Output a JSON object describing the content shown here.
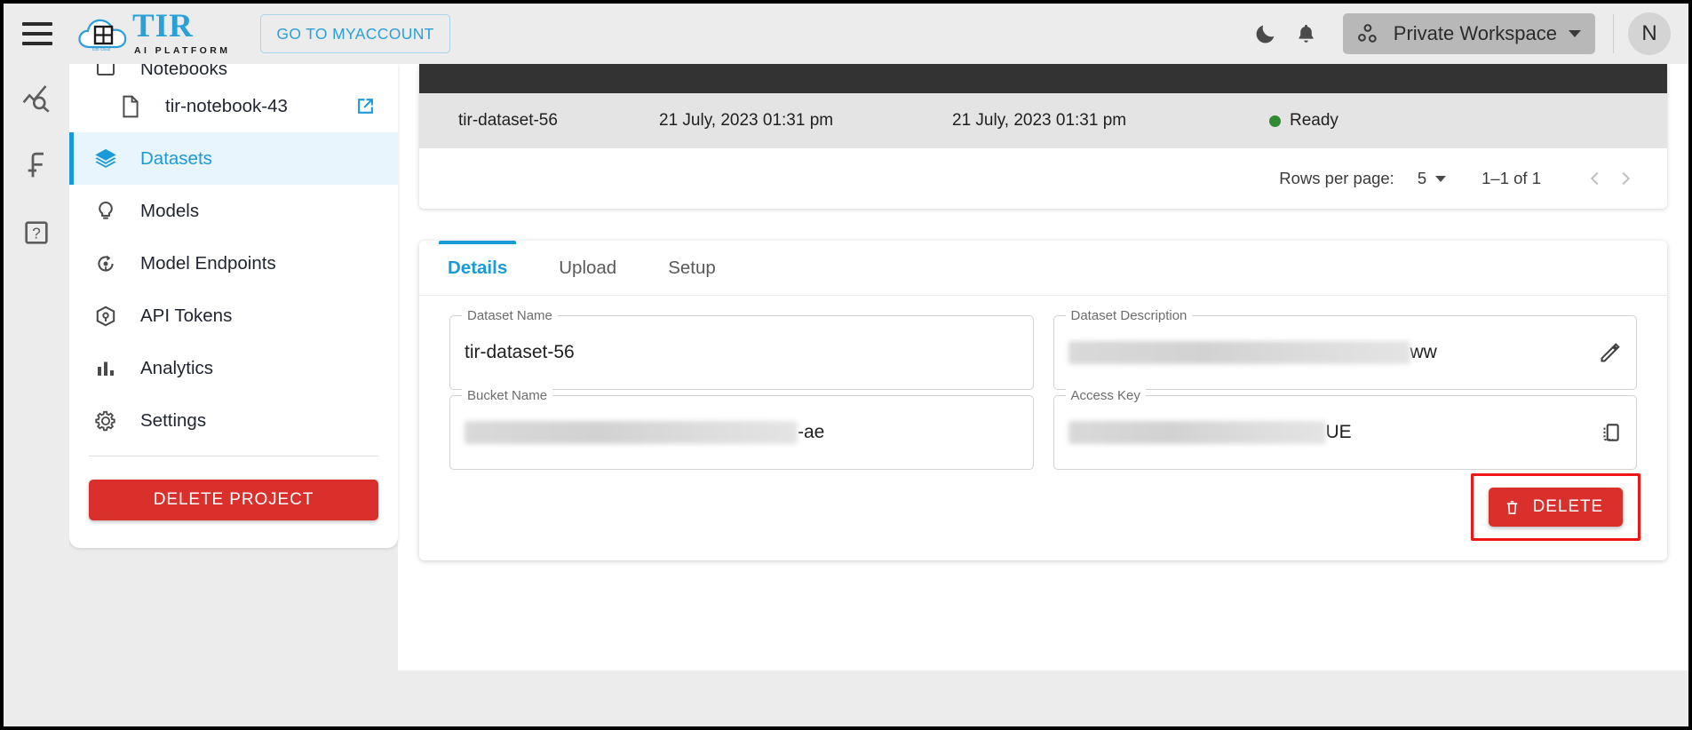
{
  "header": {
    "menu_icon": "hamburger-menu-icon",
    "brand_title": "TIR",
    "brand_subtitle": "AI PLATFORM",
    "brand_cloud_label": "E2E Cloud",
    "myaccount_label": "GO TO MYACCOUNT",
    "dark_mode_icon": "moon-icon",
    "notifications_icon": "bell-icon",
    "workspace_icon": "workspace-nodes-icon",
    "workspace_label": "Private Workspace",
    "workspace_caret": "chevron-down-icon",
    "avatar_initial": "N",
    "accent_blue": "#2a9fd8"
  },
  "rail": {
    "items": [
      {
        "icon": "chart-search-icon"
      },
      {
        "icon": "function-icon"
      },
      {
        "icon": "help-question-icon"
      }
    ]
  },
  "sidebar": {
    "items": [
      {
        "label": "Notebooks",
        "icon": "notebook-icon",
        "active": false,
        "clipped": true
      },
      {
        "label": "tir-notebook-43",
        "icon": "file-icon",
        "active": false,
        "child": true,
        "external": "external-link-icon"
      },
      {
        "label": "Datasets",
        "icon": "layers-icon",
        "active": true
      },
      {
        "label": "Models",
        "icon": "lightbulb-icon",
        "active": false
      },
      {
        "label": "Model Endpoints",
        "icon": "endpoint-refresh-icon",
        "active": false
      },
      {
        "label": "API Tokens",
        "icon": "cube-token-icon",
        "active": false
      },
      {
        "label": "Analytics",
        "icon": "bar-chart-icon",
        "active": false
      },
      {
        "label": "Settings",
        "icon": "gear-icon",
        "active": false
      }
    ],
    "delete_project_label": "DELETE PROJECT",
    "danger_color": "#d9302c"
  },
  "datasets_table": {
    "rows": [
      {
        "name": "tir-dataset-56",
        "created": "21 July, 2023 01:31 pm",
        "updated": "21 July, 2023 01:31 pm",
        "status": "Ready",
        "status_color": "#2f8a32"
      }
    ],
    "pagination": {
      "rows_per_page_label": "Rows per page:",
      "rows_per_page_value": "5",
      "range_label": "1–1 of 1",
      "prev_icon": "chevron-left-icon",
      "next_icon": "chevron-right-icon"
    }
  },
  "details_panel": {
    "tabs": [
      {
        "label": "Details",
        "active": true
      },
      {
        "label": "Upload",
        "active": false
      },
      {
        "label": "Setup",
        "active": false
      }
    ],
    "fields": {
      "dataset_name": {
        "legend": "Dataset Name",
        "value": "tir-dataset-56",
        "redacted": false
      },
      "dataset_description": {
        "legend": "Dataset Description",
        "value": "ww",
        "redacted": true,
        "trailing_icon": "edit-pencil-icon"
      },
      "bucket_name": {
        "legend": "Bucket Name",
        "value": "-ae",
        "redacted": true
      },
      "access_key": {
        "legend": "Access Key",
        "value": "UE",
        "redacted": true,
        "trailing_icon": "copy-icon"
      }
    },
    "delete_label": "DELETE",
    "delete_icon": "trash-icon",
    "highlight_color": "#f01616"
  }
}
